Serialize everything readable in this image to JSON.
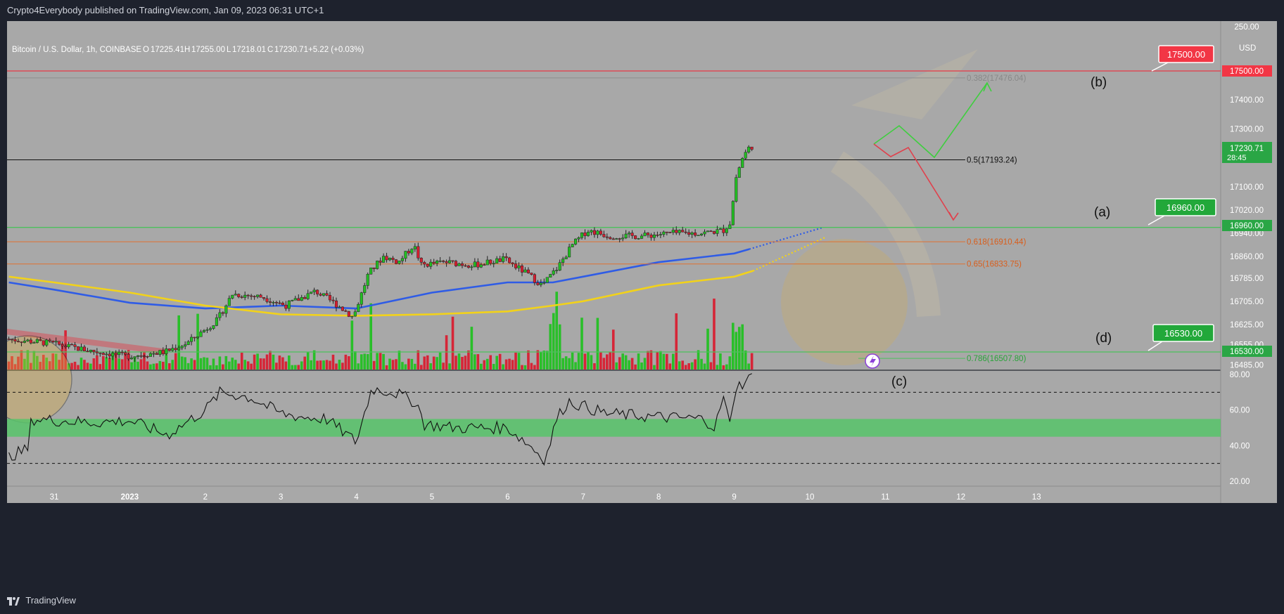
{
  "header": {
    "publisher_line": "Crypto4Everybody published on TradingView.com, Jan 09, 2023 06:31 UTC+1"
  },
  "footer": {
    "brand": "TradingView"
  },
  "legend": {
    "symbol": "Bitcoin / U.S. Dollar, 1h, COINBASE",
    "o_label": "O",
    "o_value": "17225.41",
    "h_label": "H",
    "h_value": "17255.00",
    "l_label": "L",
    "l_value": "17218.01",
    "c_label": "C",
    "c_value": "17230.71",
    "change": "+5.22 (+0.03%)"
  },
  "colors": {
    "panel_bg": "#a8a8a8",
    "frame_bg": "#1e222d",
    "up": "#22c022",
    "down": "#d81e30",
    "ema_blue": "#2f5ce6",
    "ema_yellow": "#f2d21a",
    "resistance": "#e83844",
    "support": "#4cc05c",
    "fib_orange": "#e07030",
    "rsi_band": "#57c46a"
  },
  "price_axis": {
    "currency": "USD",
    "ticks": [
      "250.00",
      "17400.00",
      "17300.00",
      "17100.00",
      "17020.00",
      "16940.00",
      "16860.00",
      "16785.00",
      "16705.00",
      "16625.00",
      "16555.00",
      "16485.00"
    ]
  },
  "rsi_axis": {
    "ticks": [
      "80.00",
      "60.00",
      "40.00",
      "20.00"
    ]
  },
  "time_axis": {
    "labels": [
      "31",
      "2023",
      "2",
      "3",
      "4",
      "5",
      "6",
      "7",
      "8",
      "9",
      "10",
      "11",
      "12",
      "13"
    ]
  },
  "levels": {
    "resistance": {
      "value": 17500,
      "label": "17500.00",
      "axis_label": "17500.00"
    },
    "support_a": {
      "value": 16960,
      "label": "16960.00",
      "axis_label": "16960.00"
    },
    "support_d": {
      "value": 16530,
      "label": "16530.00",
      "axis_label": "16530.00"
    },
    "current": {
      "value": 17230.71,
      "label": "17230.71",
      "countdown": "28:45"
    }
  },
  "fib_levels": [
    {
      "label": "0.382(17476.04)",
      "value": 17476.04
    },
    {
      "label": "0.5(17193.24)",
      "value": 17193.24
    },
    {
      "label": "0.618(16910.44)",
      "value": 16910.44
    },
    {
      "label": "0.65(16833.75)",
      "value": 16833.75
    },
    {
      "label": "0.786(16507.80)",
      "value": 16507.8
    }
  ],
  "wave_labels": [
    "(a)",
    "(b)",
    "(c)",
    "(d)"
  ],
  "chart_data": {
    "type": "candlestick",
    "symbol": "Bitcoin / U.S. Dollar",
    "interval": "1h",
    "x_range": [
      "2022-12-30",
      "2023-01-13"
    ],
    "y_range": [
      16470,
      17560
    ],
    "scenario_up_path": [
      [
        "2023-01-09 06:00",
        17255
      ],
      [
        "2023-01-09 12:00",
        17330
      ],
      [
        "2023-01-09 22:00",
        17200
      ],
      [
        "2023-01-10 14:00",
        17480
      ]
    ],
    "scenario_down_path": [
      [
        "2023-01-09 06:00",
        17255
      ],
      [
        "2023-01-09 10:00",
        17200
      ],
      [
        "2023-01-09 16:00",
        17245
      ],
      [
        "2023-01-10 04:00",
        16980
      ]
    ],
    "rsi_band": [
      45,
      55
    ],
    "rsi_lines": [
      70,
      30
    ]
  }
}
